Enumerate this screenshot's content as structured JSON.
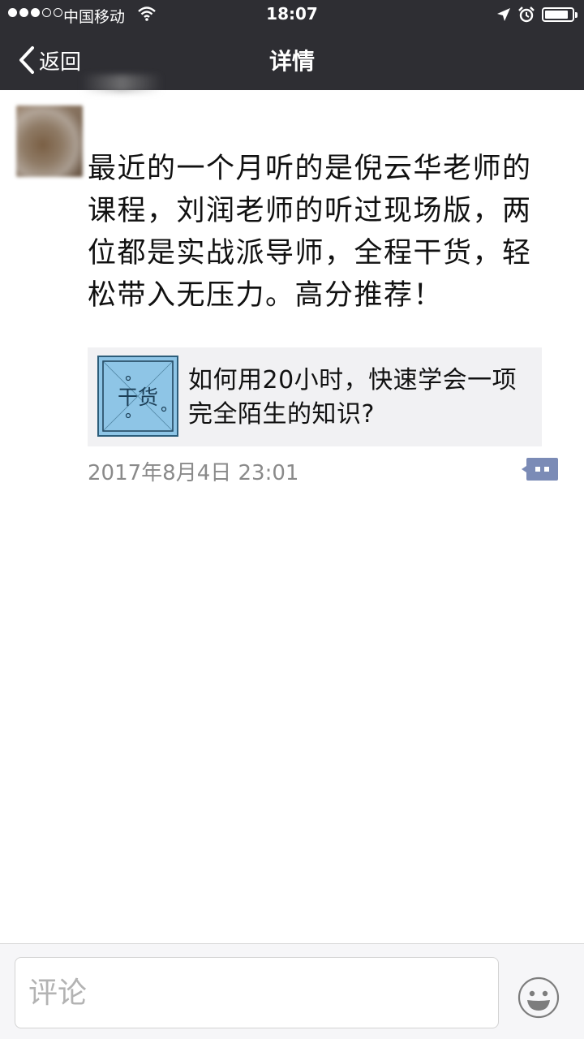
{
  "status_bar": {
    "carrier": "中国移动",
    "time": "18:07"
  },
  "nav": {
    "back_label": "返回",
    "title": "详情"
  },
  "post": {
    "text": "最近的一个月听的是倪云华老师的课程，刘润老师的听过现场版，两位都是实战派导师，全程干货，轻松带入无压力。高分推荐！",
    "link_card": {
      "thumb_text": "干货",
      "title": "如何用20小时，快速学会一项完全陌生的知识?"
    },
    "timestamp": "2017年8月4日 23:01"
  },
  "comment_bar": {
    "placeholder": "评论"
  },
  "colors": {
    "bar_bg": "#2e2e33",
    "link_card_bg": "#f1f1f3",
    "comment_icon": "#7b8bb6",
    "thumb_bg": "#8ec5e6"
  },
  "icons": [
    "signal-icon",
    "wifi-icon",
    "location-icon",
    "alarm-icon",
    "battery-icon",
    "chevron-left-icon",
    "comment-menu-icon",
    "emoji-icon"
  ]
}
